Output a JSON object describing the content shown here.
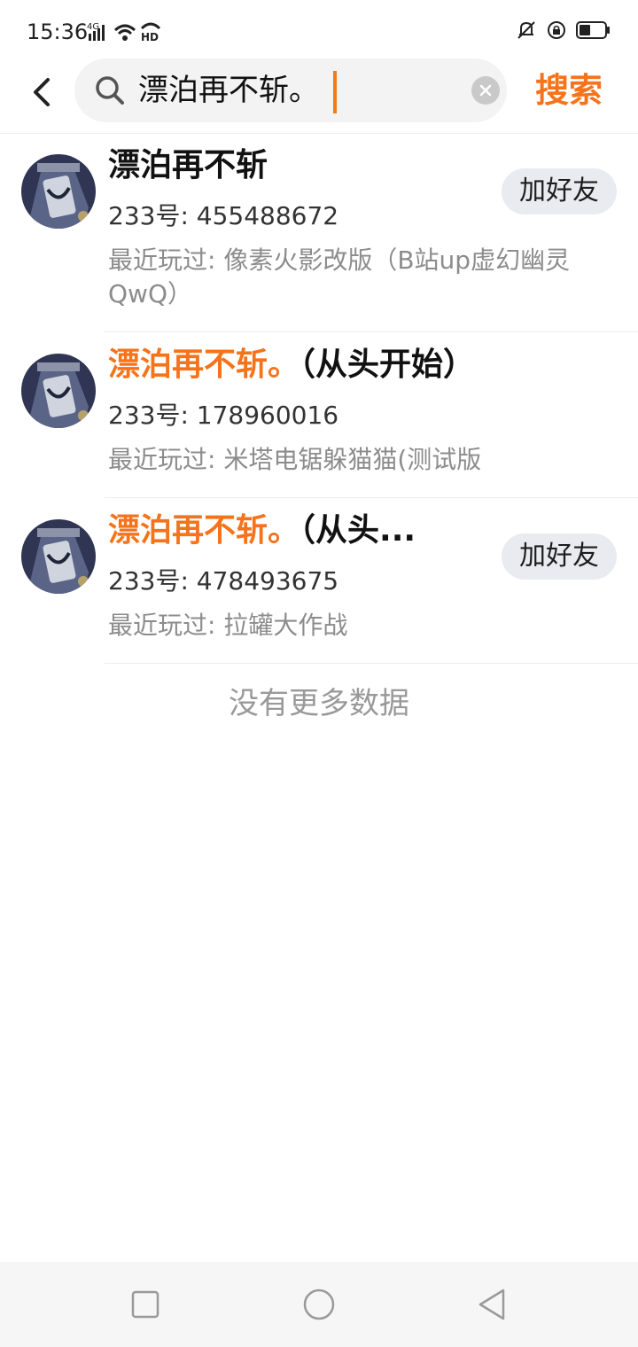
{
  "status_bar": {
    "time": "15:36",
    "network": "4G",
    "hd": "HD",
    "icons": [
      "signal-icon",
      "wifi-icon",
      "hd-call-icon",
      "bell-muted-icon",
      "rotation-lock-icon",
      "battery-icon"
    ]
  },
  "search": {
    "query": "漂泊再不斩。",
    "submit_label": "搜索"
  },
  "results": [
    {
      "name_parts": [
        {
          "text": "漂泊再不斩",
          "highlight": false
        }
      ],
      "uid": "233号: 455488672",
      "played": "最近玩过: 像素火影改版（B站up虚幻幽灵QwQ）",
      "button": "加好友"
    },
    {
      "name_parts": [
        {
          "text": "漂泊再不斩。",
          "highlight": true
        },
        {
          "text": "（从头开始）",
          "highlight": false
        }
      ],
      "uid": "233号: 178960016",
      "played": "最近玩过: 米塔电锯躲猫猫(测试版",
      "button": ""
    },
    {
      "name_parts": [
        {
          "text": "漂泊再不斩。",
          "highlight": true
        },
        {
          "text": "（从头...",
          "highlight": false
        }
      ],
      "uid": "233号: 478493675",
      "played": "最近玩过: 拉罐大作战",
      "button": "加好友"
    }
  ],
  "footer_text": "没有更多数据",
  "colors": {
    "accent": "#f5731b",
    "button_bg": "#e9ebf0"
  }
}
